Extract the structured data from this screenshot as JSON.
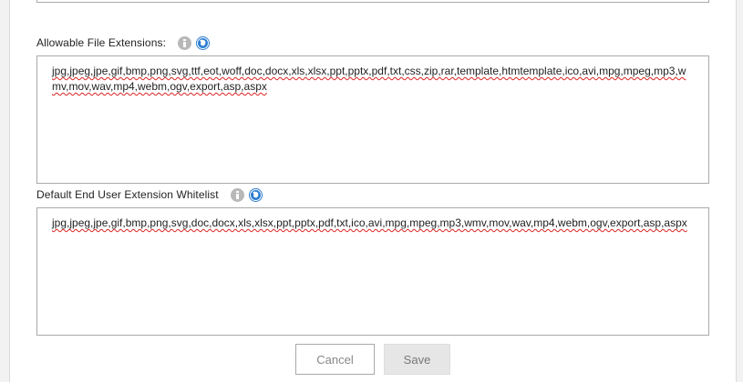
{
  "allowable": {
    "label": "Allowable File Extensions:",
    "value": "jpg,jpeg,jpe,gif,bmp,png,svg,ttf,eot,woff,doc,docx,xls,xlsx,ppt,pptx,pdf,txt,css,zip,rar,template,htmtemplate,ico,avi,mpg,mpeg,mp3,wmv,mov,wav,mp4,webm,ogv,export,asp,aspx"
  },
  "whitelist": {
    "label": "Default End User Extension Whitelist",
    "value": "jpg,jpeg,jpe,gif,bmp,png,svg,doc,docx,xls,xlsx,ppt,pptx,pdf,txt,ico,avi,mpg,mpeg,mp3,wmv,mov,wav,mp4,webm,ogv,export,asp,aspx"
  },
  "buttons": {
    "cancel": "Cancel",
    "save": "Save"
  },
  "icons": {
    "info": "info-icon",
    "globe": "globe-icon"
  },
  "colors": {
    "globe": "#2d7dd2",
    "info": "#b8b8b8",
    "spellcheck": "#dd2222"
  }
}
